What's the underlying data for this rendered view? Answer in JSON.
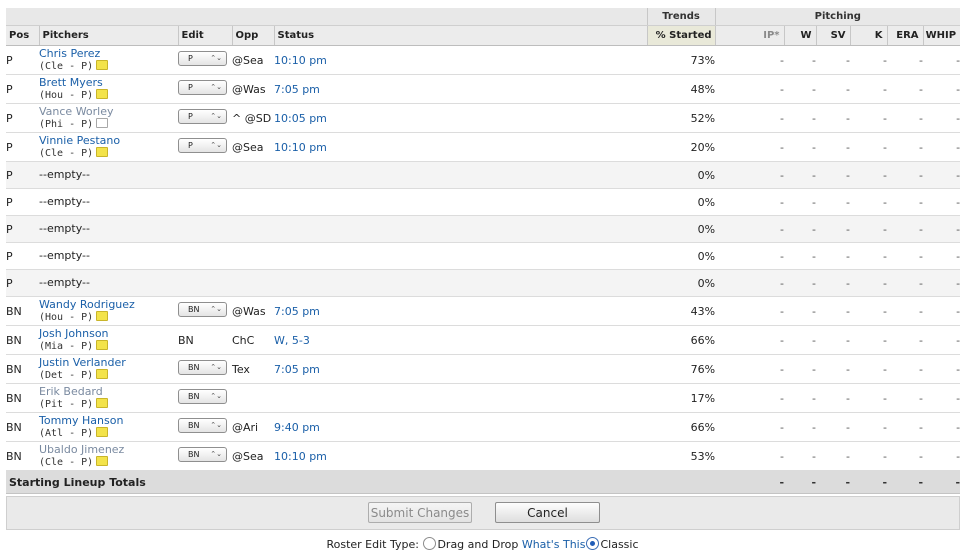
{
  "headers": {
    "trends": "Trends",
    "pitching": "Pitching",
    "pos": "Pos",
    "pitchers": "Pitchers",
    "edit": "Edit",
    "opp": "Opp",
    "status": "Status",
    "pct_started": "% Started",
    "ip": "IP*",
    "w": "W",
    "sv": "SV",
    "k": "K",
    "era": "ERA",
    "whip": "WHIP"
  },
  "rows": [
    {
      "pos": "P",
      "name": "Chris Perez",
      "team": "(Cle - P)",
      "edit": "P",
      "opp": "@Sea",
      "status": "10:10 pm",
      "pct": "73%",
      "stats": [
        "-",
        "-",
        "-",
        "-",
        "-",
        "-"
      ]
    },
    {
      "pos": "P",
      "name": "Brett Myers",
      "team": "(Hou - P)",
      "edit": "P",
      "opp": "@Was",
      "status": "7:05 pm",
      "pct": "48%",
      "stats": [
        "-",
        "-",
        "-",
        "-",
        "-",
        "-"
      ]
    },
    {
      "pos": "P",
      "name": "Vance Worley",
      "team": "(Phi - P)",
      "edit": "P",
      "opp": "^ @SD",
      "status": "10:05 pm",
      "pct": "52%",
      "stats": [
        "-",
        "-",
        "-",
        "-",
        "-",
        "-"
      ]
    },
    {
      "pos": "P",
      "name": "Vinnie Pestano",
      "team": "(Cle - P)",
      "edit": "P",
      "opp": "@Sea",
      "status": "10:10 pm",
      "pct": "20%",
      "stats": [
        "-",
        "-",
        "-",
        "-",
        "-",
        "-"
      ]
    },
    {
      "pos": "P",
      "empty": "--empty--",
      "pct": "0%",
      "stats": [
        "-",
        "-",
        "-",
        "-",
        "-",
        "-"
      ]
    },
    {
      "pos": "P",
      "empty": "--empty--",
      "pct": "0%",
      "stats": [
        "-",
        "-",
        "-",
        "-",
        "-",
        "-"
      ]
    },
    {
      "pos": "P",
      "empty": "--empty--",
      "pct": "0%",
      "stats": [
        "-",
        "-",
        "-",
        "-",
        "-",
        "-"
      ]
    },
    {
      "pos": "P",
      "empty": "--empty--",
      "pct": "0%",
      "stats": [
        "-",
        "-",
        "-",
        "-",
        "-",
        "-"
      ]
    },
    {
      "pos": "P",
      "empty": "--empty--",
      "pct": "0%",
      "stats": [
        "-",
        "-",
        "-",
        "-",
        "-",
        "-"
      ]
    },
    {
      "pos": "BN",
      "name": "Wandy Rodriguez",
      "team": "(Hou - P)",
      "edit": "BN",
      "opp": "@Was",
      "status": "7:05 pm",
      "pct": "43%",
      "stats": [
        "-",
        "-",
        "-",
        "-",
        "-",
        "-"
      ]
    },
    {
      "pos": "BN",
      "name": "Josh Johnson",
      "team": "(Mia - P)",
      "edit_text": "BN",
      "opp": "ChC",
      "status": "W, 5-3",
      "pct": "66%",
      "stats": [
        "-",
        "-",
        "-",
        "-",
        "-",
        "-"
      ]
    },
    {
      "pos": "BN",
      "name": "Justin Verlander",
      "team": "(Det - P)",
      "edit": "BN",
      "opp": "Tex",
      "status": "7:05 pm",
      "pct": "76%",
      "stats": [
        "-",
        "-",
        "-",
        "-",
        "-",
        "-"
      ]
    },
    {
      "pos": "BN",
      "name": "Erik Bedard",
      "team": "(Pit - P)",
      "edit": "BN",
      "opp": "",
      "status": "",
      "pct": "17%",
      "stats": [
        "-",
        "-",
        "-",
        "-",
        "-",
        "-"
      ]
    },
    {
      "pos": "BN",
      "name": "Tommy Hanson",
      "team": "(Atl - P)",
      "edit": "BN",
      "opp": "@Ari",
      "status": "9:40 pm",
      "pct": "66%",
      "stats": [
        "-",
        "-",
        "-",
        "-",
        "-",
        "-"
      ]
    },
    {
      "pos": "BN",
      "name": "Ubaldo Jimenez",
      "team": "(Cle - P)",
      "edit": "BN",
      "opp": "@Sea",
      "status": "10:10 pm",
      "pct": "53%",
      "stats": [
        "-",
        "-",
        "-",
        "-",
        "-",
        "-"
      ]
    }
  ],
  "totals": {
    "label": "Starting Lineup Totals",
    "stats": [
      "-",
      "-",
      "-",
      "-",
      "-",
      "-"
    ]
  },
  "actions": {
    "submit": "Submit Changes",
    "cancel": "Cancel"
  },
  "footer": {
    "label": "Roster Edit Type:",
    "drag": "Drag and Drop",
    "whats_this": "What's This",
    "classic": "Classic"
  },
  "ui": {
    "note_icon": "note-icon",
    "dropdown_arrow": "⌃⌄",
    "link_color": "#1a5fa8"
  }
}
